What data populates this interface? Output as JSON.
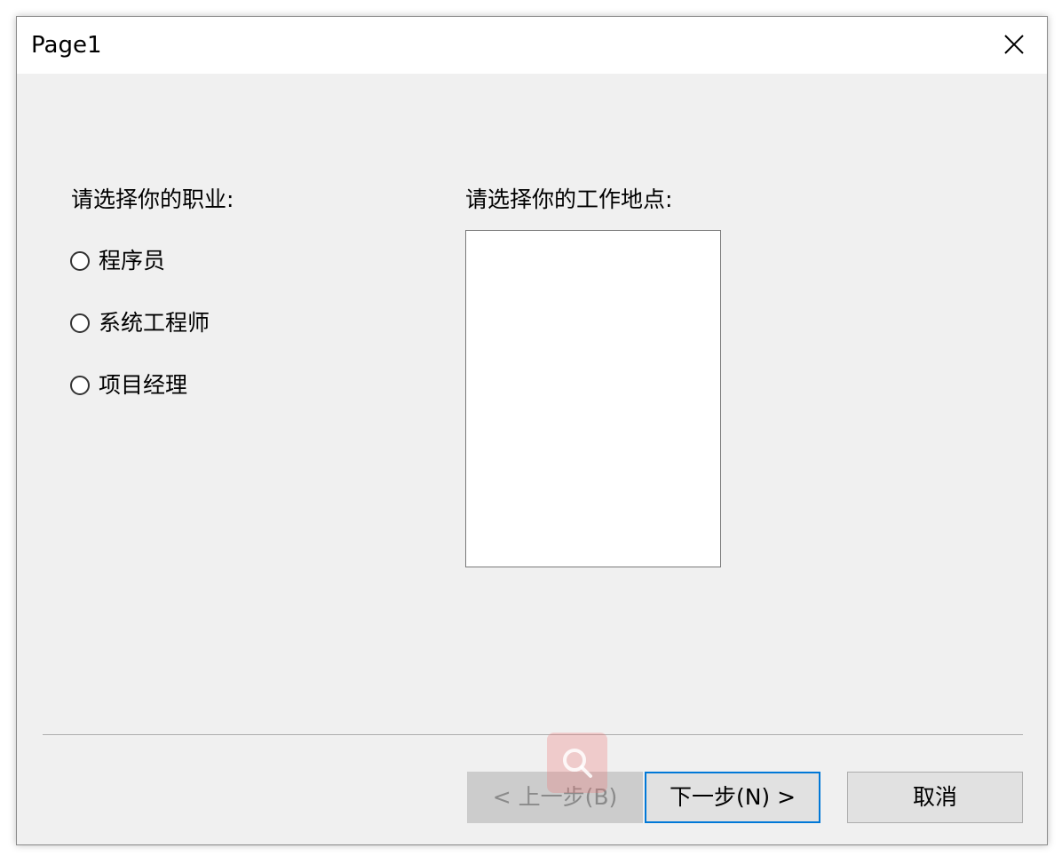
{
  "window": {
    "title": "Page1"
  },
  "occupation": {
    "label": "请选择你的职业:",
    "options": [
      {
        "label": "程序员",
        "selected": false
      },
      {
        "label": "系统工程师",
        "selected": false
      },
      {
        "label": "项目经理",
        "selected": false
      }
    ]
  },
  "location": {
    "label": "请选择你的工作地点:",
    "items": []
  },
  "buttons": {
    "back_label": "< 上一步(B)",
    "back_enabled": false,
    "next_label": "下一步(N) >",
    "cancel_label": "取消"
  },
  "icons": {
    "close": "close-icon",
    "watermark": "search-icon"
  },
  "colors": {
    "focus_border": "#0078d7",
    "dialog_background": "#f0f0f0"
  }
}
